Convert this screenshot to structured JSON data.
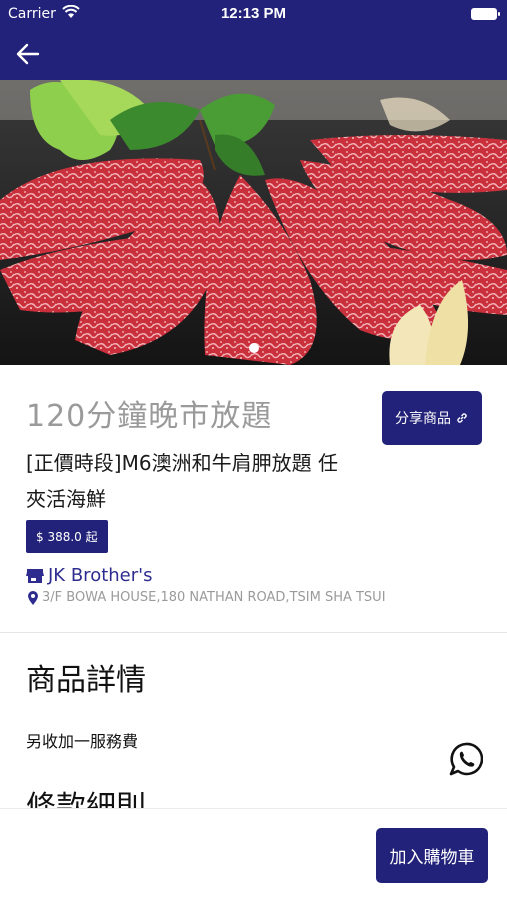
{
  "status_bar": {
    "carrier": "Carrier",
    "time": "12:13 PM"
  },
  "product": {
    "title": "120分鐘晚市放題",
    "description": "[正價時段]M6澳洲和牛肩胛放題 任夾活海鮮",
    "price": "$ 388.0 起",
    "share_label": "分享商品",
    "shop_name": "JK Brother's",
    "address": "3/F BOWA HOUSE,180 NATHAN ROAD,TSIM SHA TSUI"
  },
  "details": {
    "section_title": "商品詳情",
    "service_note": "另收加一服務費",
    "terms_title": "條款細則"
  },
  "carousel": {
    "total": 1,
    "active": 0
  },
  "bottom_bar": {
    "cart_label": "加入購物車"
  },
  "colors": {
    "brand": "#23227a",
    "shop_link": "#2e2d8f"
  }
}
